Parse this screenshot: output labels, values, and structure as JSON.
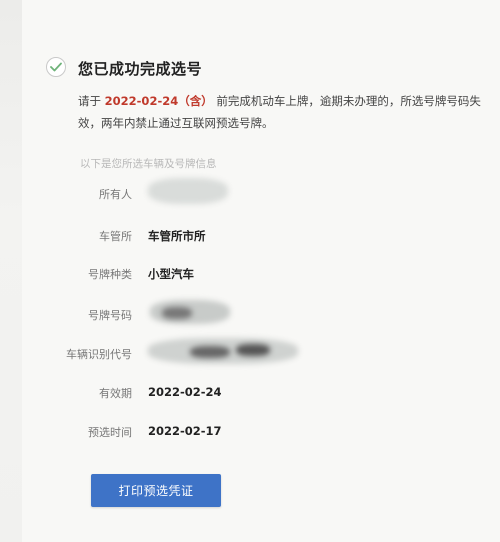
{
  "header": {
    "title": "您已成功完成选号"
  },
  "notice": {
    "prefix": "请于",
    "deadline": "2022-02-24（含）",
    "suffix": "前完成机动车上牌，逾期未办理的，所选号牌号码失效，两年内禁止通过互联网预选号牌。"
  },
  "section": {
    "label": "以下是您所选车辆及号牌信息"
  },
  "rows": [
    {
      "label": "所有人",
      "value": ""
    },
    {
      "label": "车管所",
      "value": "车管所市所"
    },
    {
      "label": "号牌种类",
      "value": "小型汽车"
    },
    {
      "label": "号牌号码",
      "value": ""
    },
    {
      "label": "车辆识别代号",
      "value": ""
    },
    {
      "label": "有效期",
      "value": "2022-02-24"
    },
    {
      "label": "预选时间",
      "value": "2022-02-17"
    }
  ],
  "actions": {
    "print_label": "打印预选凭证"
  },
  "colors": {
    "accent": "#3e73c7",
    "highlight": "#c0392b"
  },
  "icons": {
    "success": "check-circle-icon"
  }
}
